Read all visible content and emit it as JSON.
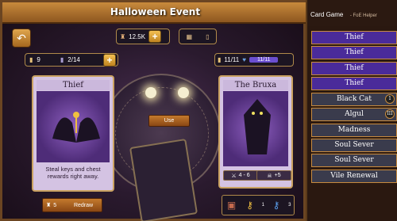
{
  "event": {
    "title": "Halloween Event",
    "currency_value": "12.5K",
    "keys_value": "9",
    "chests_value": "2/14",
    "deck_count": "11/11",
    "deck_bar": "11/11",
    "use_label": "Use",
    "redraw_cost": "5",
    "redraw_label": "Redraw"
  },
  "left_card": {
    "name": "Thief",
    "description": "Steal keys and chest rewards right away."
  },
  "right_card": {
    "name": "The Bruxa",
    "attack_range": "4 - 6",
    "bonus": "+5"
  },
  "bottom_tray": {
    "reward1_count": "1",
    "reward2_count": "3"
  },
  "sidebar": {
    "title": "Card Game",
    "subtitle": "- FoE Helper",
    "items": [
      {
        "label": "Thief",
        "style": "purple"
      },
      {
        "label": "Thief",
        "style": "purple"
      },
      {
        "label": "Thief",
        "style": "purple"
      },
      {
        "label": "Thief",
        "style": "purple"
      },
      {
        "label": "Black Cat",
        "style": "dark",
        "badge": "1"
      },
      {
        "label": "Algul",
        "style": "dark",
        "badge": "III"
      },
      {
        "label": "Madness",
        "style": "dark"
      },
      {
        "label": "Soul Sever",
        "style": "dark"
      },
      {
        "label": "Soul Sever",
        "style": "dark"
      },
      {
        "label": "Vile Renewal",
        "style": "dark"
      }
    ]
  },
  "colors": {
    "accent": "#c88a3c",
    "card_purple": "#4a2b9a",
    "card_dark": "#3a3b4c"
  }
}
